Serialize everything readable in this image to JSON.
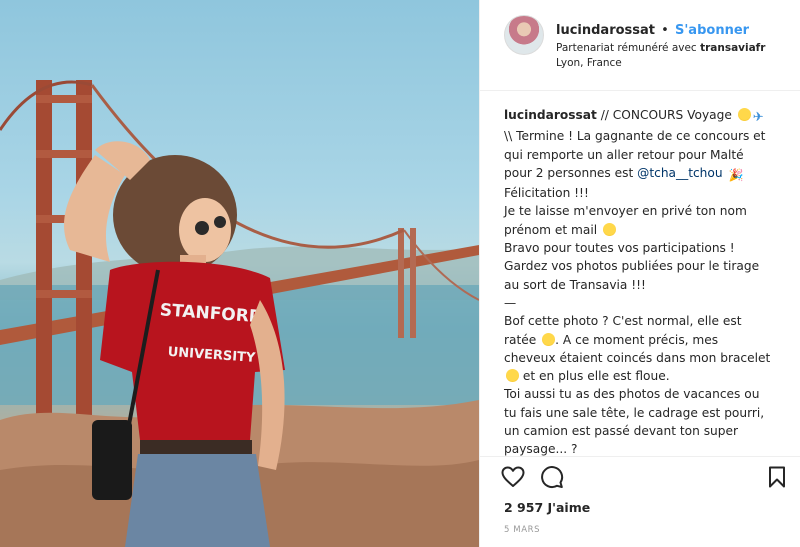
{
  "photo": {
    "shirt_text_top": "STANFORD",
    "shirt_text_bottom": "UNIVERSITY"
  },
  "header": {
    "username": "lucindarossat",
    "separator": "•",
    "follow_label": "S'abonner",
    "partnership_prefix": "Partenariat rémunéré avec",
    "partner": "transaviafr",
    "location": "Lyon, France"
  },
  "caption": {
    "author": "lucindarossat",
    "lines": [
      " // CONCOURS Voyage",
      "\\\\ Termine ! La gagnante de ce concours et",
      "qui remporte un aller retour pour Malté",
      "pour 2 personnes est ",
      "Félicitation !!!",
      "Je te laisse m'envoyer en privé ton nom",
      "prénom et mail",
      "Bravo pour toutes vos participations !",
      "Gardez vos photos publiées pour le tirage",
      "au sort de Transavia !!!",
      "—",
      "Bof cette photo ? C'est normal, elle est",
      "ratée",
      ". A ce moment précis, mes",
      "cheveux étaient coincés dans mon bracelet",
      " et en plus elle est floue.",
      "Toi aussi tu as des photos de vacances ou",
      "tu fais une sale tête, le cadrage est pourri,",
      "un camion est passé devant ton super",
      "paysage... ?"
    ],
    "mention": "@tcha__tchou"
  },
  "actions": {
    "likes": "2 957 J'aime",
    "date": "5 MARS"
  },
  "colors": {
    "accent": "#3897f0",
    "text": "#262626",
    "muted": "#999999",
    "mention": "#003569",
    "border": "#efefef"
  },
  "icons": [
    "heart-icon",
    "comment-icon",
    "bookmark-icon"
  ]
}
